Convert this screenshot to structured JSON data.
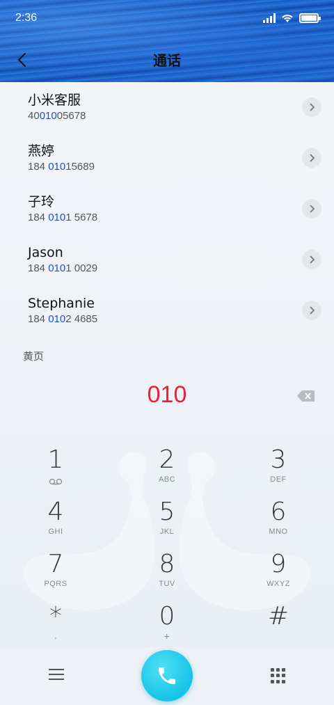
{
  "status_bar": {
    "time": "2:36"
  },
  "header": {
    "title": "通话"
  },
  "contacts": [
    {
      "name": "小米客服",
      "number_pre": "40",
      "number_match": "010",
      "number_post": "05678"
    },
    {
      "name": "燕婷",
      "number_pre": "184 ",
      "number_match": "010",
      "number_post": "15689"
    },
    {
      "name": "子玲",
      "number_pre": "184 ",
      "number_match": "010",
      "number_post": "1 5678"
    },
    {
      "name": "Jason",
      "number_pre": "184 ",
      "number_match": "010",
      "number_post": "1 0029"
    },
    {
      "name": "Stephanie",
      "number_pre": "184 ",
      "number_match": "010",
      "number_post": "2 4685"
    }
  ],
  "section": {
    "yellow_pages": "黄页"
  },
  "dial_entry": "010",
  "keys": [
    {
      "digit": "1",
      "letters": ""
    },
    {
      "digit": "2",
      "letters": "ABC"
    },
    {
      "digit": "3",
      "letters": "DEF"
    },
    {
      "digit": "4",
      "letters": "GHI"
    },
    {
      "digit": "5",
      "letters": "JKL"
    },
    {
      "digit": "6",
      "letters": "MNO"
    },
    {
      "digit": "7",
      "letters": "PQRS"
    },
    {
      "digit": "8",
      "letters": "TUV"
    },
    {
      "digit": "9",
      "letters": "WXYZ"
    },
    {
      "digit": "*",
      "letters": ","
    },
    {
      "digit": "0",
      "letters": "+"
    },
    {
      "digit": "#",
      "letters": ""
    }
  ],
  "icons": {
    "back": "chevron-left-icon",
    "detail": "chevron-right-icon",
    "backspace": "backspace-icon",
    "voicemail": "voicemail-icon",
    "menu": "menu-icon",
    "call": "phone-icon",
    "dialpad": "dialpad-icon"
  },
  "colors": {
    "entry": "#e8203a",
    "match_highlight": "#1f4fd1",
    "call_button": "#17c3e6"
  }
}
